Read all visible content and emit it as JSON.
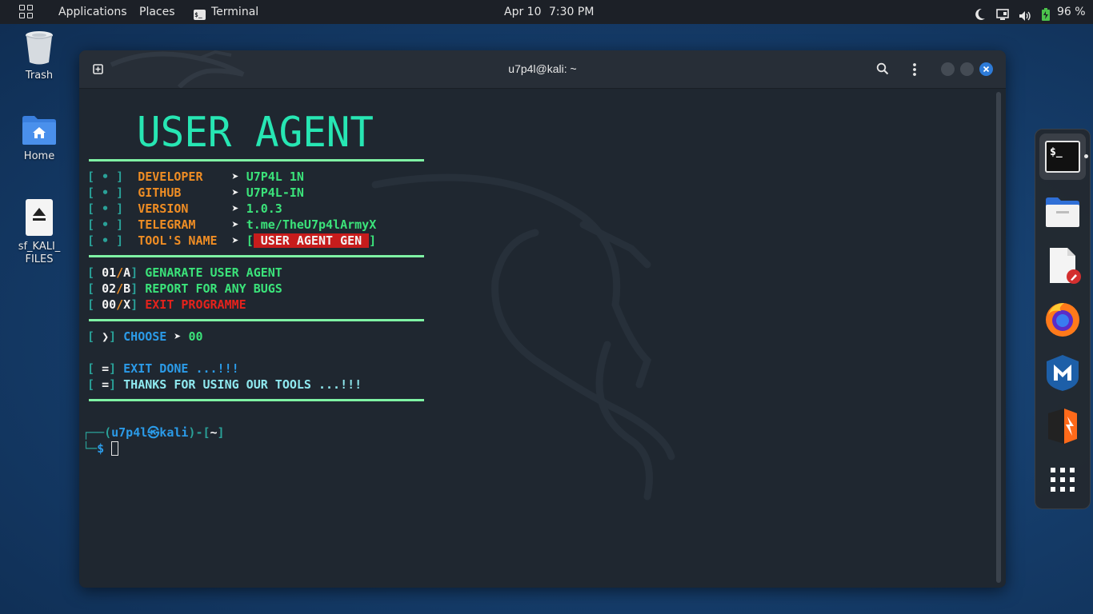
{
  "topbar": {
    "applications": "Applications",
    "places": "Places",
    "terminal": "Terminal",
    "date": "Apr 10",
    "time": "7:30 PM",
    "battery": "96 %"
  },
  "desktop": {
    "icons": [
      {
        "label": "Trash"
      },
      {
        "label": "Home"
      },
      {
        "label_line1": "sf_KALI_",
        "label_line2": "FILES"
      }
    ]
  },
  "window": {
    "title": "u7p4l@kali: ~"
  },
  "terminal": {
    "banner": "USER AGENT",
    "info": [
      {
        "bullet": "[ • ]",
        "label": "DEVELOPER    ",
        "arrow": "➤",
        "value": "U7P4L 1N"
      },
      {
        "bullet": "[ • ]",
        "label": "GITHUB       ",
        "arrow": "➤",
        "value": "U7P4L-IN"
      },
      {
        "bullet": "[ • ]",
        "label": "VERSION      ",
        "arrow": "➤",
        "value": "1.0.3"
      },
      {
        "bullet": "[ • ]",
        "label": "TELEGRAM     ",
        "arrow": "➤",
        "value": "t.me/TheU7p4lArmyX"
      }
    ],
    "tool_name": {
      "bullet": "[ • ]",
      "label": "TOOL'S NAME  ",
      "arrow": "➤",
      "open": "[",
      "value": "USER AGENT GEN",
      "close": "]"
    },
    "menu": [
      {
        "open": "[",
        "code": "01",
        "slash": "/",
        "key": "A",
        "close": "]",
        "text": "GENARATE USER AGENT"
      },
      {
        "open": "[",
        "code": "02",
        "slash": "/",
        "key": "B",
        "close": "]",
        "text": "REPORT FOR ANY BUGS"
      },
      {
        "open": "[",
        "code": "00",
        "slash": "/",
        "key": "X",
        "close": "]",
        "text": "EXIT PROGRAMME"
      }
    ],
    "choose": {
      "open": "[",
      "mark": "❯",
      "close": "]",
      "label": "CHOOSE",
      "arrow": "➤",
      "value": "00"
    },
    "exit_lines": [
      {
        "open": "[",
        "mark": "=",
        "close": "]",
        "text": "EXIT DONE ...!!!"
      },
      {
        "open": "[",
        "mark": "=",
        "close": "]",
        "text": "THANKS FOR USING OUR TOOLS ...!!!"
      }
    ],
    "prompt": {
      "corner_top": "┌──(",
      "user": "u7p4l",
      "at": "㉿",
      "host": "kali",
      "mid": ")-[",
      "dir": "~",
      "end": "]",
      "corner_bottom": "└─",
      "dollar": "$"
    }
  },
  "colors": {
    "accent_green": "#3be37a",
    "label_orange": "#ef8d24",
    "exit_red": "#e5221c",
    "prompt_blue": "#2b9be8",
    "close_button": "#2d7bd8"
  },
  "dock": {
    "items": [
      "terminal-icon",
      "files-icon",
      "text-editor-icon",
      "firefox-icon",
      "metasploit-icon",
      "burpsuite-icon",
      "app-grid-icon"
    ]
  }
}
